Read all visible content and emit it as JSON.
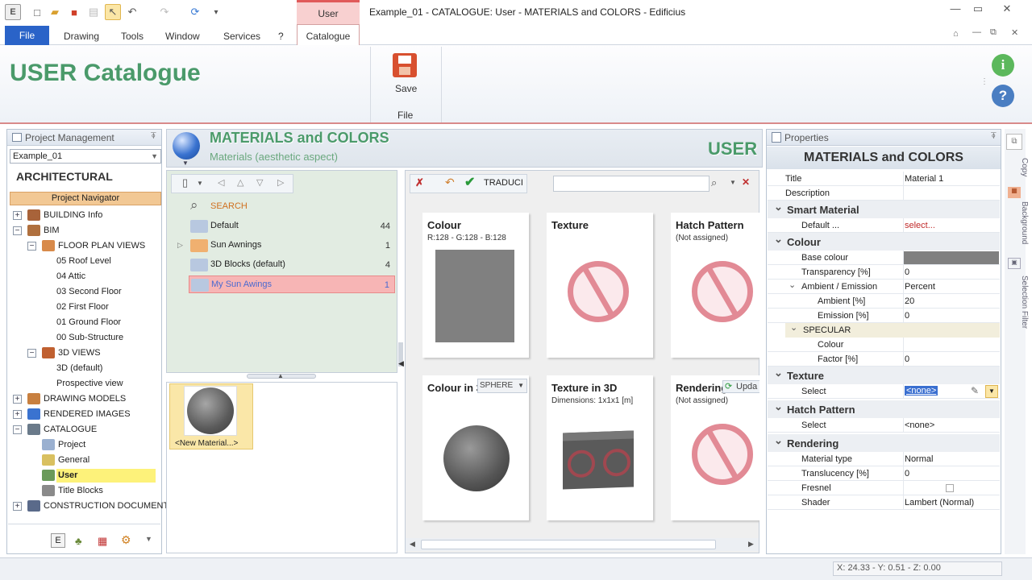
{
  "window": {
    "title": "Example_01 -  CATALOGUE: User - MATERIALS and COLORS - Edificius",
    "context_tab": "User"
  },
  "menu": {
    "file": "File",
    "drawing": "Drawing",
    "tools": "Tools",
    "window": "Window",
    "services": "Services",
    "help": "?",
    "catalogue": "Catalogue"
  },
  "ribbon": {
    "heading": "USER Catalogue",
    "save_label": "Save",
    "group_label": "File"
  },
  "project": {
    "panel_title": "Project Management",
    "pin": "⍕",
    "project_select": "Example_01",
    "section": "ARCHITECTURAL",
    "navigator": "Project Navigator"
  },
  "tree": [
    {
      "label": "BUILDING Info",
      "box": "+"
    },
    {
      "label": "BIM",
      "box": "−"
    },
    {
      "label": "FLOOR PLAN VIEWS",
      "box": "−"
    },
    {
      "label": "05 Roof Level"
    },
    {
      "label": "04 Attic"
    },
    {
      "label": "03 Second Floor"
    },
    {
      "label": "02 First Floor"
    },
    {
      "label": "01 Ground Floor"
    },
    {
      "label": "00 Sub-Structure"
    },
    {
      "label": "3D VIEWS",
      "box": "−"
    },
    {
      "label": "3D (default)"
    },
    {
      "label": "Prospective view"
    },
    {
      "label": "DRAWING MODELS",
      "box": "+"
    },
    {
      "label": "RENDERED IMAGES",
      "box": "+"
    },
    {
      "label": "CATALOGUE",
      "box": "−"
    },
    {
      "label": "Project"
    },
    {
      "label": "General"
    },
    {
      "label": "User"
    },
    {
      "label": "Title Blocks"
    },
    {
      "label": "CONSTRUCTION DOCUMENTS",
      "box": "+"
    }
  ],
  "catalog": {
    "title": "MATERIALS and COLORS",
    "subtitle": "Materials (aesthetic aspect)",
    "badge": "USER"
  },
  "folders": [
    {
      "name": "SEARCH",
      "count": ""
    },
    {
      "name": "Default",
      "count": "44"
    },
    {
      "name": "Sun Awnings",
      "count": "1"
    },
    {
      "name": "3D Blocks (default)",
      "count": "4"
    },
    {
      "name": "My Sun Awings",
      "count": "1"
    }
  ],
  "new_material": "<New Material...>",
  "toolbar": {
    "translate": "TRADUCI"
  },
  "cards": [
    {
      "title": "Colour",
      "sub": "R:128 - G:128 - B:128"
    },
    {
      "title": "Texture",
      "sub": ""
    },
    {
      "title": "Hatch Pattern",
      "sub": "(Not assigned)"
    },
    {
      "title": "Colour in 3",
      "sub": "",
      "dropdown": "SPHERE"
    },
    {
      "title": "Texture in 3D",
      "sub": "Dimensions: 1x1x1 [m]"
    },
    {
      "title": "Rendering",
      "sub": "(Not assigned)",
      "button": "Upda"
    }
  ],
  "props": {
    "panel_title": "Properties",
    "header": "MATERIALS and COLORS",
    "title_label": "Title",
    "title_value": "Material 1",
    "description_label": "Description",
    "smart_material": "Smart Material",
    "default_label": "Default ...",
    "default_value": "select...",
    "colour": "Colour",
    "base_colour": "Base colour",
    "transparency": "Transparency [%]",
    "transparency_val": "0",
    "ambient_emission": "Ambient / Emission",
    "ambient_emission_val": "Percent",
    "ambient": "Ambient [%]",
    "ambient_val": "20",
    "emission": "Emission [%]",
    "emission_val": "0",
    "specular": "SPECULAR",
    "spec_colour": "Colour",
    "factor": "Factor [%]",
    "factor_val": "0",
    "texture": "Texture",
    "select": "Select",
    "tex_select_val": "<none>",
    "hatch": "Hatch Pattern",
    "hatch_select_val": "<none>",
    "rendering": "Rendering",
    "material_type": "Material type",
    "material_type_val": "Normal",
    "translucency": "Translucency  [%]",
    "translucency_val": "0",
    "fresnel": "Fresnel",
    "shader": "Shader",
    "shader_val": "Lambert (Normal)"
  },
  "sidetabs": {
    "copy": "Copy",
    "background": "Background",
    "filter": "Selection Filter"
  },
  "status": {
    "coords": "X: 24.33 - Y: 0.51 - Z: 0.00"
  },
  "colors": {
    "accent": "#2a63c8",
    "context": "#e05a5a",
    "green": "#4a9a6a",
    "base_colour": "#808080"
  }
}
